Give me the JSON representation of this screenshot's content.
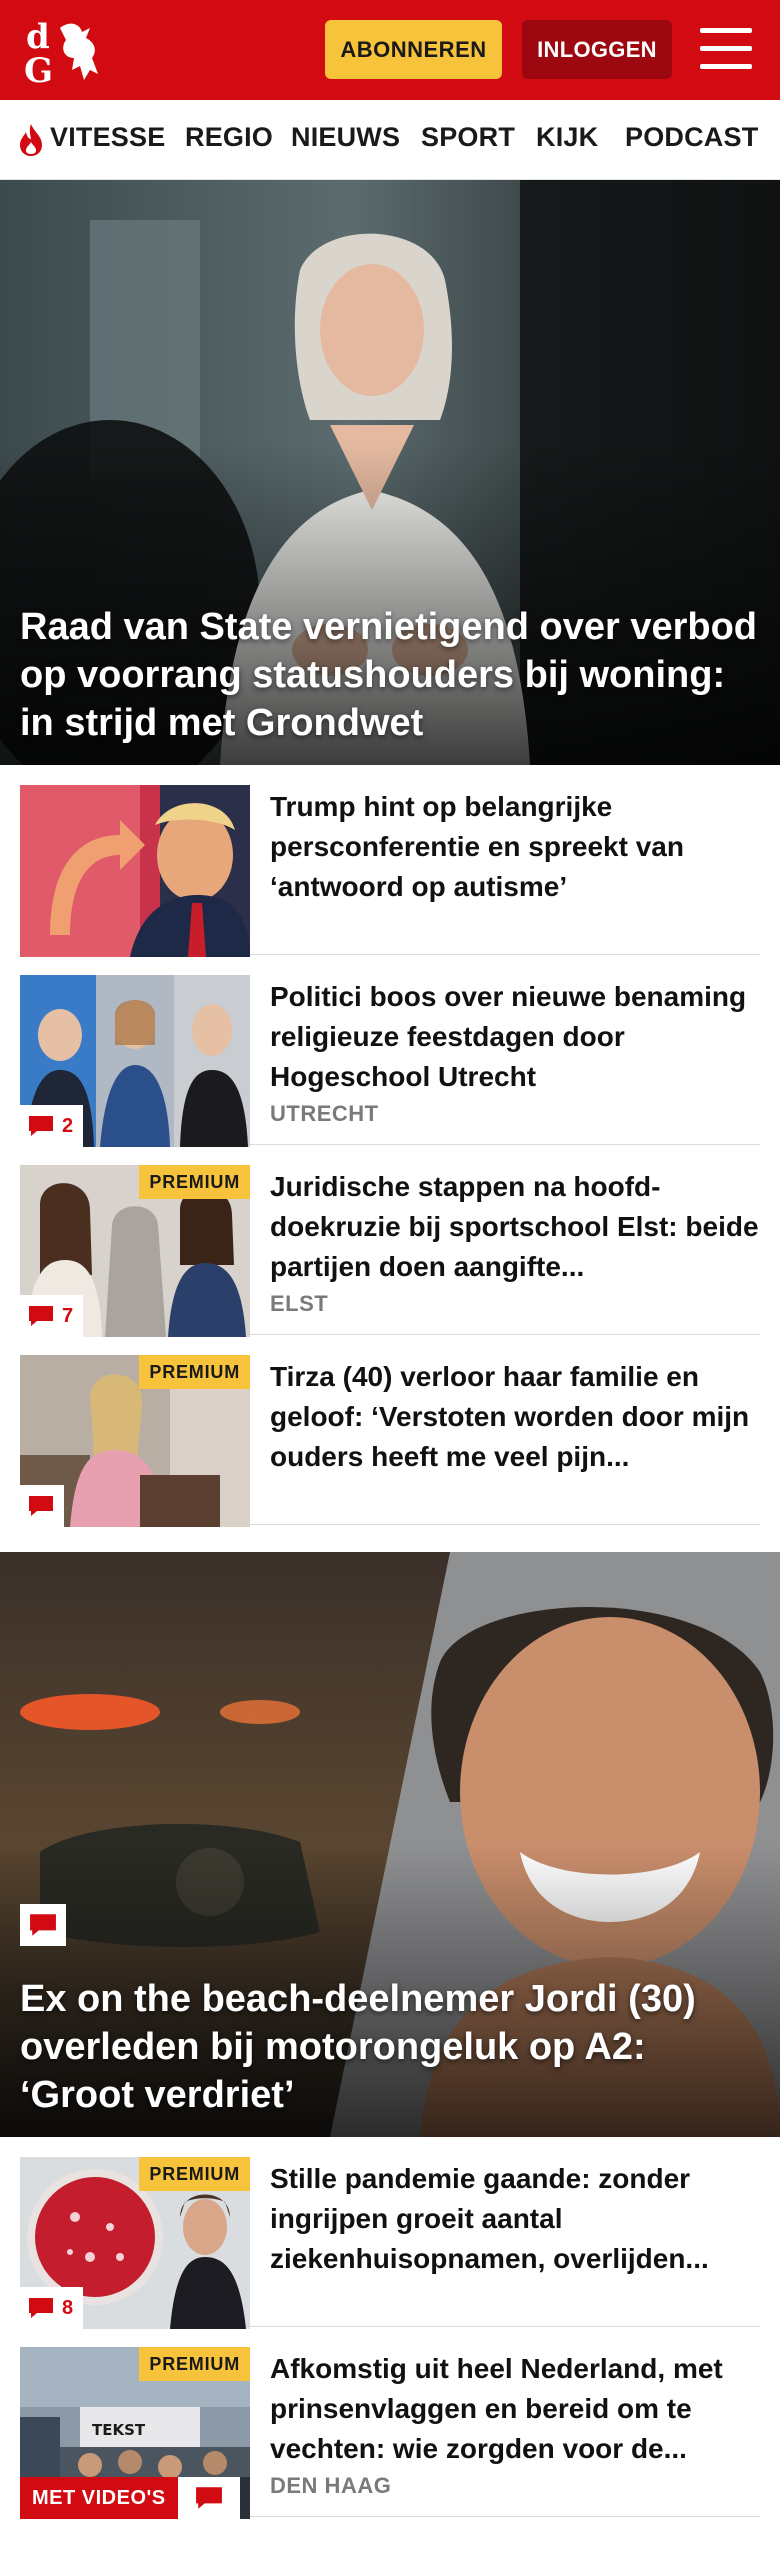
{
  "header": {
    "logo_text": "dG",
    "subscribe_label": "ABONNEREN",
    "login_label": "INLOGGEN",
    "menu_icon": "hamburger-icon",
    "brand_color": "#d20a11",
    "subscribe_color": "#f7c33a",
    "login_color": "#9c0710"
  },
  "nav": {
    "items": [
      {
        "label": "VITESSE",
        "icon": "flame-icon"
      },
      {
        "label": "REGIO"
      },
      {
        "label": "NIEUWS"
      },
      {
        "label": "SPORT"
      },
      {
        "label": "KIJK"
      },
      {
        "label": "PODCAST"
      }
    ]
  },
  "hero": {
    "headline": "Raad van State vernietigend over verbod op voorrang statushouders bij woning: in strijd met Grondwet"
  },
  "articles": [
    {
      "title": "Trump hint op belangrijke persconferentie en spreekt van ‘antwoord op autisme’",
      "tag": "",
      "premium": "",
      "comments": ""
    },
    {
      "title": "Politici boos over nieuwe benaming religieuze feestdagen door Hogeschool Utrecht",
      "tag": "UTRECHT",
      "premium": "",
      "comments": "2"
    },
    {
      "title": "Juridische stappen na hoofd­doekruzie bij sportschool Elst: beide partijen doen aangifte...",
      "tag": "ELST",
      "premium": "PREMIUM",
      "comments": "7"
    },
    {
      "title": "Tirza (40) verloor haar familie en geloof: ‘Verstoten worden door mijn ouders heeft me veel pijn...",
      "tag": "",
      "premium": "PREMIUM",
      "comments": ""
    }
  ],
  "hero2": {
    "headline": "Ex on the beach-deelnemer Jordi (30) overleden bij motorongeluk op A2: ‘Groot verdriet’"
  },
  "articles2": [
    {
      "title": "Stille pandemie gaande: zonder ingrijpen groeit aantal ziekenhuisopnamen, overlijden...",
      "tag": "",
      "premium": "PREMIUM",
      "comments": "8"
    },
    {
      "title": "Afkomstig uit heel Nederland, met prinsenvlaggen en bereid om te vechten: wie zorgden voor de...",
      "tag": "DEN HAAG",
      "premium": "PREMIUM",
      "video_badge": "MET VIDEO'S",
      "comments": ""
    }
  ]
}
